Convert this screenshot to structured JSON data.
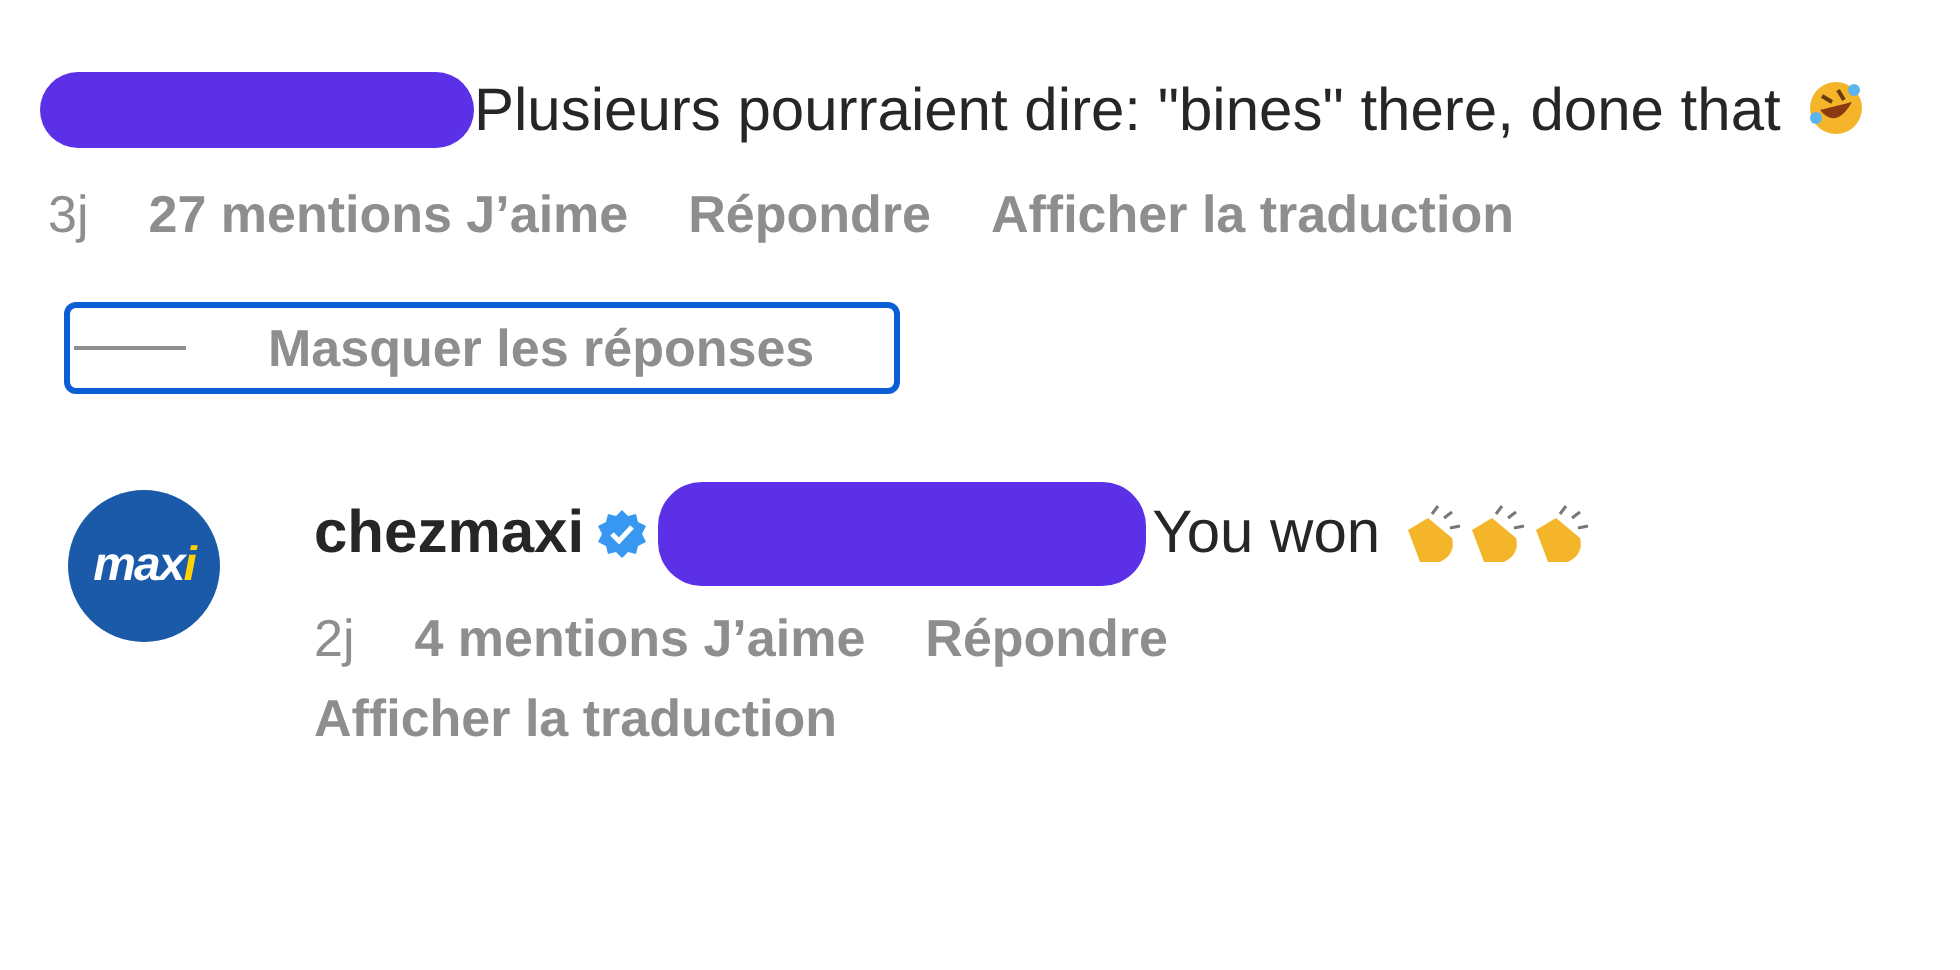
{
  "comment": {
    "text": "Plusieurs pourraient dire: \"bines\" there, done that",
    "meta": {
      "age": "3j",
      "likes": "27 mentions J’aime",
      "reply": "Répondre",
      "translate": "Afficher la traduction"
    }
  },
  "replies_toggle": {
    "label": "Masquer les réponses",
    "focused": true
  },
  "reply": {
    "avatar": "maxi",
    "username": "chezmaxi",
    "verified": true,
    "text": "You won",
    "meta": {
      "age": "2j",
      "likes": "4 mentions J’aime",
      "reply": "Répondre",
      "translate": "Afficher la traduction"
    }
  }
}
